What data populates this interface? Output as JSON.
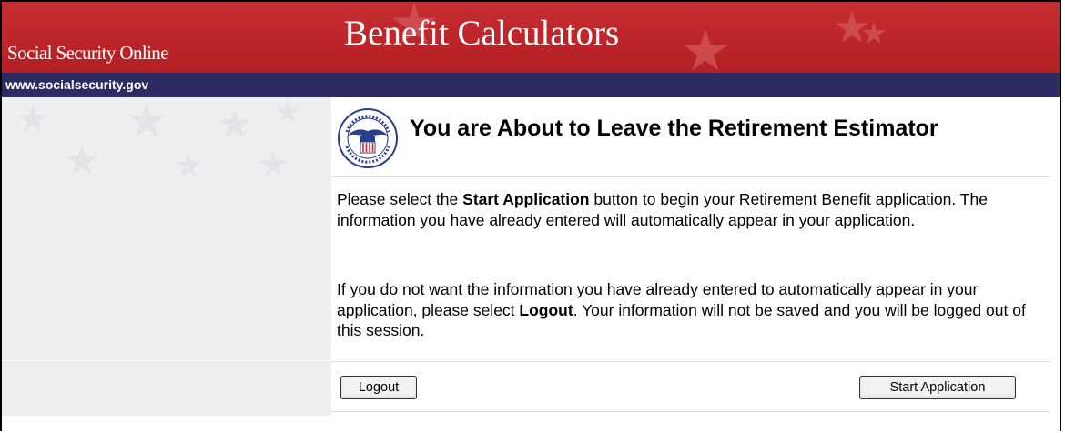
{
  "banner": {
    "site_name": "Social Security Online",
    "title": "Benefit Calculators",
    "url": "www.socialsecurity.gov"
  },
  "content": {
    "seal_icon": "ssa-seal-icon",
    "heading": "You are About to Leave the Retirement Estimator",
    "p1": {
      "before": "Please select the ",
      "bold": "Start Application",
      "after": " button to begin your Retirement Benefit application. The information you have already entered will automatically appear in your application."
    },
    "p2": {
      "before": "If you do not want the information you have already entered to automatically appear in your application, please select ",
      "bold": "Logout",
      "after": ". Your information will not be saved and you will be logged out of this session."
    }
  },
  "buttons": {
    "logout": "Logout",
    "start": "Start Application"
  },
  "colors": {
    "banner_red": "#c62d31",
    "url_bar_navy": "#2c2c63",
    "sidebar_gray": "#eeeeee"
  }
}
